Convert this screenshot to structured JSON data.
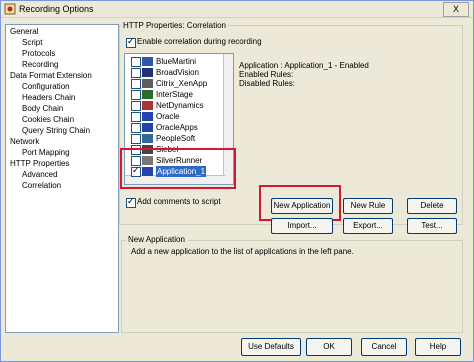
{
  "window": {
    "title": "Recording Options",
    "close_label": "X"
  },
  "tree": [
    {
      "label": "General",
      "level": 0
    },
    {
      "label": "Script",
      "level": 1
    },
    {
      "label": "Protocols",
      "level": 1
    },
    {
      "label": "Recording",
      "level": 1
    },
    {
      "label": "Data Format Extension",
      "level": 0
    },
    {
      "label": "Configuration",
      "level": 1
    },
    {
      "label": "Headers Chain",
      "level": 1
    },
    {
      "label": "Body Chain",
      "level": 1
    },
    {
      "label": "Cookies Chain",
      "level": 1
    },
    {
      "label": "Query String Chain",
      "level": 1
    },
    {
      "label": "Network",
      "level": 0
    },
    {
      "label": "Port Mapping",
      "level": 1
    },
    {
      "label": "HTTP Properties",
      "level": 0
    },
    {
      "label": "Advanced",
      "level": 1
    },
    {
      "label": "Correlation",
      "level": 1
    }
  ],
  "group": {
    "title": "HTTP Properties: Correlation"
  },
  "enable": {
    "label": "Enable correlation during recording",
    "checked": true
  },
  "apps": [
    {
      "label": "BlueMartini",
      "checked": false,
      "icon": "bluemartini-icon",
      "color": "#3355aa"
    },
    {
      "label": "BroadVision",
      "checked": false,
      "icon": "broadvision-icon",
      "color": "#223377"
    },
    {
      "label": "Citrix_XenApp",
      "checked": false,
      "icon": "citrix-icon",
      "color": "#5f5f5f"
    },
    {
      "label": "InterStage",
      "checked": false,
      "icon": "interstage-icon",
      "color": "#2a6a2a"
    },
    {
      "label": "NetDynamics",
      "checked": false,
      "icon": "netdynamics-icon",
      "color": "#aa3333"
    },
    {
      "label": "Oracle",
      "checked": false,
      "icon": "oracle-icon",
      "color": "#2244aa"
    },
    {
      "label": "OracleApps",
      "checked": false,
      "icon": "oracleapps-icon",
      "color": "#2244aa"
    },
    {
      "label": "PeopleSoft",
      "checked": false,
      "icon": "peoplesoft-icon",
      "color": "#336699"
    },
    {
      "label": "Siebel",
      "checked": false,
      "icon": "siebel-icon",
      "color": "#444444"
    },
    {
      "label": "SilverRunner",
      "checked": false,
      "icon": "silverrunner-icon",
      "color": "#777777"
    },
    {
      "label": "Application_1",
      "checked": true,
      "icon": "application-icon",
      "color": "#2244aa"
    }
  ],
  "info": {
    "line1": "Application : Application_1 - Enabled",
    "line2": "Enabled Rules:",
    "line3": "Disabled Rules:"
  },
  "comments": {
    "label": "Add comments to script",
    "checked": true
  },
  "buttons": {
    "new_application": "New Application",
    "new_rule": "New Rule",
    "delete": "Delete",
    "import": "Import...",
    "export": "Export...",
    "test": "Test..."
  },
  "desc": {
    "title": "New Application",
    "text": "Add a new application to the list of applications in the left pane."
  },
  "footer": {
    "use_defaults": "Use Defaults",
    "ok": "OK",
    "cancel": "Cancel",
    "help": "Help"
  },
  "colors": {
    "highlight": "#d8162f",
    "selection": "#316ac5"
  }
}
